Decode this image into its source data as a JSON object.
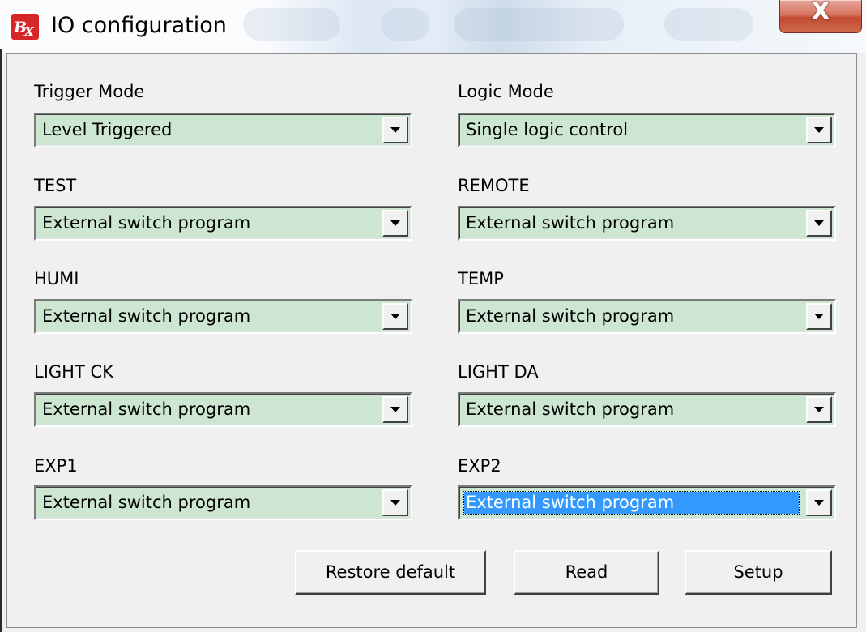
{
  "window": {
    "title": "IO configuration",
    "close_label": "X",
    "icon": "app-logo-icon",
    "icon_text": "BX"
  },
  "fields": {
    "trigger_mode": {
      "label": "Trigger Mode",
      "value": "Level Triggered"
    },
    "logic_mode": {
      "label": "Logic Mode",
      "value": "Single logic control"
    },
    "test": {
      "label": "TEST",
      "value": "External switch program"
    },
    "remote": {
      "label": "REMOTE",
      "value": "External switch program"
    },
    "humi": {
      "label": "HUMI",
      "value": "External switch program"
    },
    "temp": {
      "label": "TEMP",
      "value": "External switch program"
    },
    "light_ck": {
      "label": "LIGHT CK",
      "value": "External switch program"
    },
    "light_da": {
      "label": "LIGHT DA",
      "value": "External switch program"
    },
    "exp1": {
      "label": "EXP1",
      "value": "External switch program"
    },
    "exp2": {
      "label": "EXP2",
      "value": "External switch program"
    }
  },
  "buttons": {
    "restore_default": "Restore default",
    "read": "Read",
    "setup": "Setup"
  },
  "colors": {
    "combo_background": "#cde6d2",
    "selection": "#3399ff",
    "close_button": "#c9553c",
    "icon_red": "#d7262a"
  }
}
